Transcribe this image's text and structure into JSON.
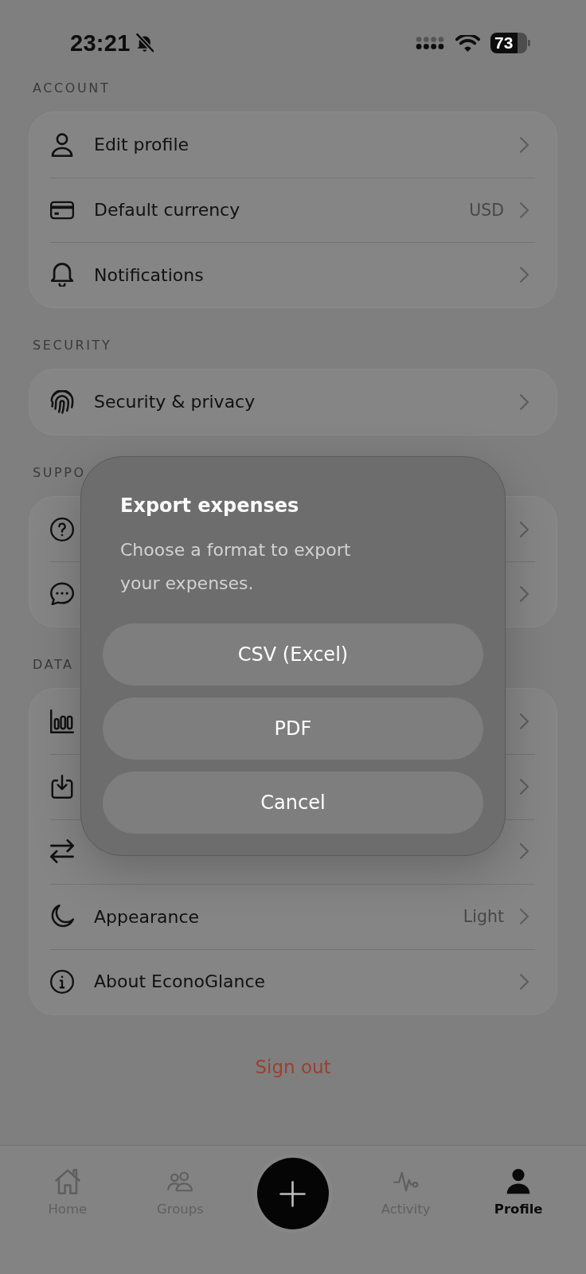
{
  "status_bar": {
    "time": "23:21",
    "battery": "73"
  },
  "sections": [
    {
      "title": "ACCOUNT",
      "items": [
        {
          "label": "Edit profile",
          "chevron": true
        },
        {
          "label": "Default currency",
          "value": "USD",
          "chevron": true
        },
        {
          "label": "Notifications",
          "chevron": true
        }
      ]
    },
    {
      "title": "SECURITY",
      "items": [
        {
          "label": "Security & privacy",
          "chevron": true
        }
      ]
    },
    {
      "title": "SUPPO",
      "items": [
        {
          "chevron": true
        },
        {
          "chevron": true
        }
      ]
    },
    {
      "title": "DATA",
      "items": [
        {
          "chevron": true
        },
        {
          "chevron": true
        },
        {
          "chevron": true
        },
        {
          "label": "Appearance",
          "value": "Light",
          "chevron": true
        },
        {
          "label": "About EconoGlance",
          "chevron": true
        }
      ]
    }
  ],
  "sign_out": "Sign out",
  "dialog": {
    "title": "Export expenses",
    "message": "Choose a format to export your expenses.",
    "buttons": [
      "CSV (Excel)",
      "PDF",
      "Cancel"
    ]
  },
  "tab_bar": {
    "items": [
      {
        "kind": "tab",
        "label": "Home",
        "selected": false
      },
      {
        "kind": "tab",
        "label": "Groups",
        "selected": false
      },
      {
        "kind": "add"
      },
      {
        "kind": "tab",
        "label": "Activity",
        "selected": false
      },
      {
        "kind": "tab",
        "label": "Profile",
        "selected": true
      }
    ]
  }
}
